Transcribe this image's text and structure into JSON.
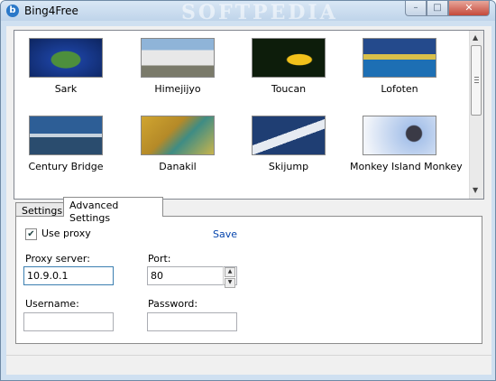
{
  "window": {
    "title": "Bing4Free",
    "watermark": "SOFTPEDIA",
    "controls": {
      "minimize": "–",
      "maximize": "□",
      "close": "✕"
    }
  },
  "gallery": {
    "items": [
      {
        "caption": "Sark",
        "icon": "island-photo",
        "colors": [
          "#1b3f9a",
          "#3a7d3b"
        ]
      },
      {
        "caption": "Himejijyo",
        "icon": "castle-photo",
        "colors": [
          "#8fb4d8",
          "#e8e8e8"
        ]
      },
      {
        "caption": "Toucan",
        "icon": "toucan-photo",
        "colors": [
          "#0d1d0b",
          "#f2c21b"
        ]
      },
      {
        "caption": "Lofoten",
        "icon": "lofoten-photo",
        "colors": [
          "#244a8c",
          "#d9c04a"
        ]
      },
      {
        "caption": "Century Bridge",
        "icon": "bridge-photo",
        "colors": [
          "#2d5e96",
          "#c7d3de"
        ]
      },
      {
        "caption": "Danakil",
        "icon": "danakil-photo",
        "colors": [
          "#b58a28",
          "#3e8c84"
        ]
      },
      {
        "caption": "Skijump",
        "icon": "skijump-photo",
        "colors": [
          "#1f3e73",
          "#e6ebf2"
        ]
      },
      {
        "caption": "Monkey Island Monkey",
        "icon": "monkey-photo",
        "colors": [
          "#a9c3ea",
          "#f2f5fa"
        ]
      }
    ]
  },
  "tabs": [
    {
      "label": "Settings",
      "active": false
    },
    {
      "label": "Advanced Settings",
      "active": true
    }
  ],
  "advanced": {
    "use_proxy_label": "Use proxy",
    "use_proxy_checked": "✔",
    "save_label": "Save",
    "proxy_server_label": "Proxy server:",
    "proxy_server_value": "10.9.0.1",
    "port_label": "Port:",
    "port_value": "80",
    "username_label": "Username:",
    "username_value": "",
    "password_label": "Password:",
    "password_value": ""
  }
}
